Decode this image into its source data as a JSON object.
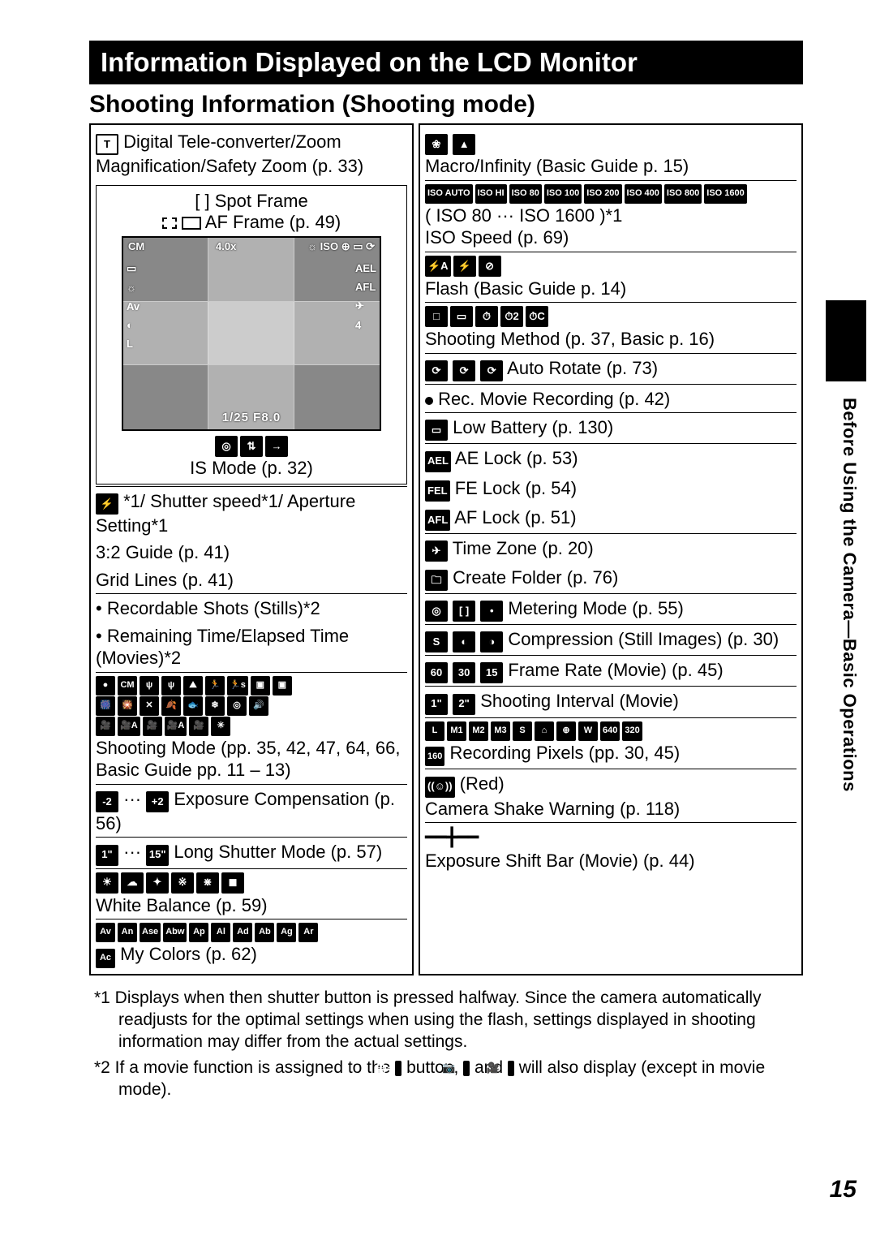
{
  "header": {
    "title": "Information Displayed on the LCD Monitor",
    "subtitle": "Shooting Information (Shooting mode)"
  },
  "side_tab_label": "Before Using the Camera—Basic Operations",
  "page_number": "15",
  "screen_overlay": {
    "top_left": "CM",
    "top_mid": "4.0x",
    "bottom": "1/25   F8.0",
    "right_num": "4"
  },
  "left": {
    "i1": "Digital Tele-converter/Zoom Magnification/Safety Zoom (p. 33)",
    "i2": "[   ] Spot Frame",
    "i3": "AF Frame (p. 49)",
    "is_mode": "IS Mode (p. 32)",
    "shutter": "*1/ Shutter speed*1/ Aperture Setting*1",
    "guide32": "3:2 Guide (p. 41)",
    "gridlines": "Grid Lines (p. 41)",
    "rec_shots": "• Recordable Shots (Stills)*2",
    "rem_time": "• Remaining Time/Elapsed Time (Movies)*2",
    "shooting_mode": "Shooting Mode (pp. 35, 42, 47, 64, 66, Basic Guide pp. 11 – 13)",
    "exp_comp": "Exposure Compensation (p. 56)",
    "long_shutter": "Long Shutter Mode (p. 57)",
    "wb": "White Balance (p. 59)",
    "mycolors": "My Colors (p. 62)"
  },
  "right": {
    "macro": "Macro/Infinity (Basic Guide p. 15)",
    "iso_note": "( ISO 80 ··· ISO 1600 )*1",
    "iso": "ISO Speed (p. 69)",
    "flash": "Flash (Basic Guide p. 14)",
    "method": "Shooting Method (p. 37, Basic p. 16)",
    "autorotate": "Auto Rotate (p. 73)",
    "rec_movie": "Rec. Movie Recording (p. 42)",
    "lowbatt": "Low Battery (p. 130)",
    "ae_lock": "AE Lock (p. 53)",
    "fe_lock": "FE Lock (p. 54)",
    "af_lock": "AF Lock (p. 51)",
    "timezone": "Time Zone (p. 20)",
    "create_folder": "Create Folder (p. 76)",
    "metering": "Metering Mode (p. 55)",
    "compression": "Compression (Still Images) (p. 30)",
    "framerate": "Frame Rate (Movie) (p. 45)",
    "interval": "Shooting Interval (Movie)",
    "recpix": "Recording Pixels (pp. 30, 45)",
    "red": "(Red)",
    "shake": "Camera Shake Warning (p. 118)",
    "expshift": "Exposure Shift Bar (Movie) (p. 44)"
  },
  "footnotes": {
    "f1": "*1 Displays when then shutter button is pressed halfway. Since the camera automatically readjusts for the optimal settings when using the flash, settings displayed in shooting information may differ from the actual settings.",
    "f2_a": "*2 If a movie function is assigned to the ",
    "f2_b": " button, ",
    "f2_c": " and ",
    "f2_d": " will also display (except in movie mode)."
  },
  "icons": {
    "T": "T",
    "flash": "⚡",
    "ISO_list": [
      "ISO AUTO",
      "ISO HI",
      "ISO 80",
      "ISO 100",
      "ISO 200",
      "ISO 400",
      "ISO 800",
      "ISO 1600"
    ],
    "flash_set": [
      "⚡A",
      "⚡",
      "⊘"
    ],
    "drive": [
      "□",
      "▭",
      "⏱",
      "⏱2",
      "⏱C"
    ],
    "rotate": [
      "⟳",
      "⟳",
      "⟳"
    ],
    "rec_dot": "●",
    "batt": "▭",
    "AEL": "AEL",
    "FEL": "FEL",
    "AFL": "AFL",
    "plane": "✈",
    "folder": "🗀",
    "meter": [
      "◎",
      "[ ]",
      "•"
    ],
    "comp": [
      "S",
      "◐",
      "◑"
    ],
    "fps": [
      "60",
      "30",
      "15"
    ],
    "interval": [
      "1\"",
      "2\""
    ],
    "recpix": [
      "L",
      "M1",
      "M2",
      "M3",
      "S",
      "⌂",
      "⊕",
      "W",
      "640",
      "320",
      "160"
    ],
    "shake": "((☺))",
    "is": [
      "◎",
      "⇅",
      "→"
    ],
    "minus2": "-2",
    "plus2": "+2",
    "one": "1\"",
    "fifteen": "15\"",
    "wb": [
      "☀",
      "☁",
      "✦",
      "※",
      "⋇",
      "◼"
    ],
    "mc": [
      "Av",
      "An",
      "Ase",
      "Abw",
      "Ap",
      "Al",
      "Ad",
      "Ab",
      "Ag",
      "Ar",
      "Ac"
    ],
    "modes1": [
      "●",
      "CM",
      "ψ",
      "ψ",
      "⛰",
      "🏃",
      "🏃s",
      "▣",
      "▣"
    ],
    "modes2": [
      "🎆",
      "🎇",
      "✕",
      "🍂",
      "🐟",
      "❄",
      "◎",
      "🔊"
    ],
    "modes3": [
      "🎥",
      "🎥A",
      "🎥",
      "🎥A",
      "🎥",
      "✳"
    ],
    "print": "🖨~",
    "cam": "📷",
    "movie": "🎥",
    "bar": "━━╋━━"
  }
}
